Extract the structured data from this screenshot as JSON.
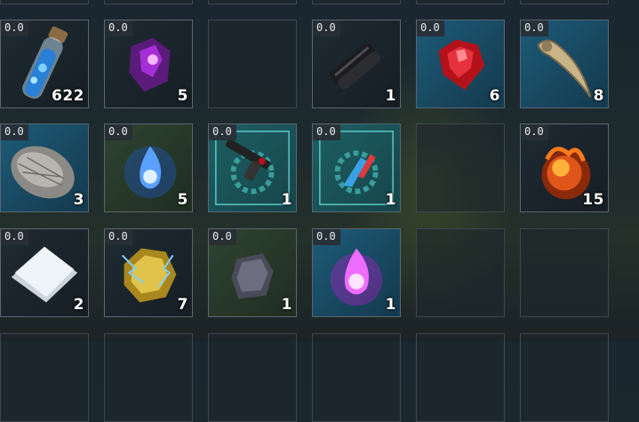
{
  "inventory": {
    "slots": [
      {
        "item_icon": "blue-vial-icon",
        "weight": "0.0",
        "quantity": "622"
      },
      {
        "item_icon": "purple-crystal-icon",
        "weight": "0.0",
        "quantity": "5"
      },
      {
        "item_icon": "empty-slot",
        "weight": "",
        "quantity": ""
      },
      {
        "item_icon": "black-leather-icon",
        "weight": "0.0",
        "quantity": "1"
      },
      {
        "item_icon": "red-gem-icon",
        "weight": "0.0",
        "quantity": "6"
      },
      {
        "item_icon": "horn-icon",
        "weight": "0.0",
        "quantity": "8"
      },
      {
        "item_icon": "fur-pelt-icon",
        "weight": "0.0",
        "quantity": "3"
      },
      {
        "item_icon": "blue-flame-icon",
        "weight": "0.0",
        "quantity": "5"
      },
      {
        "item_icon": "gun-blueprint-icon",
        "weight": "0.0",
        "quantity": "1"
      },
      {
        "item_icon": "component-blueprint-icon",
        "weight": "0.0",
        "quantity": "1"
      },
      {
        "item_icon": "empty-slot",
        "weight": "",
        "quantity": ""
      },
      {
        "item_icon": "fire-orb-icon",
        "weight": "0.0",
        "quantity": "15"
      },
      {
        "item_icon": "paper-icon",
        "weight": "0.0",
        "quantity": "2"
      },
      {
        "item_icon": "electric-ore-icon",
        "weight": "0.0",
        "quantity": "7"
      },
      {
        "item_icon": "stone-icon",
        "weight": "0.0",
        "quantity": "1"
      },
      {
        "item_icon": "pink-flame-icon",
        "weight": "0.0",
        "quantity": "1"
      },
      {
        "item_icon": "empty-slot",
        "weight": "",
        "quantity": ""
      },
      {
        "item_icon": "empty-slot",
        "weight": "",
        "quantity": ""
      }
    ]
  }
}
